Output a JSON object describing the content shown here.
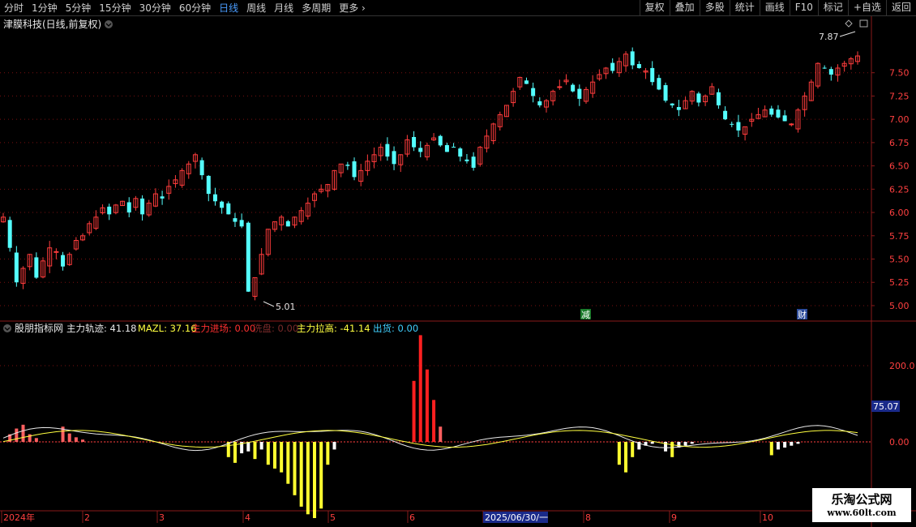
{
  "toolbar": {
    "timeframes": [
      {
        "label": "分时"
      },
      {
        "label": "1分钟"
      },
      {
        "label": "5分钟"
      },
      {
        "label": "15分钟"
      },
      {
        "label": "30分钟"
      },
      {
        "label": "60分钟"
      },
      {
        "label": "日线",
        "active": true
      },
      {
        "label": "周线"
      },
      {
        "label": "月线"
      },
      {
        "label": "多周期"
      },
      {
        "label": "更多"
      }
    ],
    "tools": [
      "复权",
      "叠加",
      "多股",
      "统计",
      "画线",
      "F10",
      "标记",
      "+自选",
      "返回"
    ]
  },
  "main_title": "津膜科技(日线,前复权)",
  "indicator_title": "股朋指标网",
  "indicator_values": [
    {
      "label": "主力轨迹: 41.18",
      "color": "#e8e8e8"
    },
    {
      "label": "MAZL: 37.16",
      "color": "#ffff40"
    },
    {
      "label": "主力进场: 0.00",
      "color": "#ff3030"
    },
    {
      "label": "洗盘: 0.00",
      "color": "#7a2a2a"
    },
    {
      "label": "主力拉高: -41.14",
      "color": "#ffff40"
    },
    {
      "label": "出货: 0.00",
      "color": "#40d0ff"
    }
  ],
  "price_axis": [
    "7.50",
    "7.25",
    "7.00",
    "6.75",
    "6.50",
    "6.25",
    "6.00",
    "5.75",
    "5.50",
    "5.25",
    "5.00"
  ],
  "indicator_axis": [
    "200.0",
    "0.00"
  ],
  "indicator_current": "75.07",
  "high_label": "7.87",
  "low_label": "5.01",
  "markers": [
    {
      "text": "减",
      "color": "#1a7a2a"
    },
    {
      "text": "财",
      "color": "#2a4a9a"
    }
  ],
  "date_axis": [
    "2024年",
    "2",
    "3",
    "4",
    "5",
    "6",
    "2025/06/30/一",
    "8",
    "9",
    "10"
  ],
  "watermark": {
    "line1": "乐淘公式网",
    "line2": "www.60lt.com"
  },
  "colors": {
    "up": "#ff3c3c",
    "down": "#54ffff",
    "grid": "#7a1010"
  },
  "chart_data": [
    {
      "type": "candlestick",
      "title": "津膜科技(日线,前复权)",
      "ylim": [
        4.93,
        7.95
      ],
      "yticks": [
        5.0,
        5.25,
        5.5,
        5.75,
        6.0,
        6.25,
        6.5,
        6.75,
        7.0,
        7.25,
        7.5
      ],
      "annotations": [
        {
          "text": "7.87",
          "type": "high"
        },
        {
          "text": "5.01",
          "type": "low"
        }
      ],
      "close_path": [
        5.95,
        5.62,
        5.25,
        5.4,
        5.55,
        5.3,
        5.48,
        5.62,
        5.58,
        5.42,
        5.55,
        5.7,
        5.75,
        5.88,
        5.95,
        6.05,
        5.98,
        6.08,
        6.12,
        6.0,
        6.15,
        5.98,
        6.1,
        6.2,
        6.15,
        6.28,
        6.35,
        6.45,
        6.52,
        6.62,
        6.4,
        6.2,
        6.12,
        6.05,
        5.98,
        5.9,
        5.85,
        5.15,
        5.3,
        5.55,
        5.82,
        5.9,
        5.95,
        5.85,
        5.95,
        6.02,
        6.1,
        6.2,
        6.25,
        6.3,
        6.45,
        6.52,
        6.5,
        6.38,
        6.45,
        6.55,
        6.62,
        6.7,
        6.6,
        6.52,
        6.62,
        6.78,
        6.7,
        6.65,
        6.72,
        6.8,
        6.72,
        6.65,
        6.7,
        6.6,
        6.55,
        6.48,
        6.7,
        6.82,
        6.95,
        7.05,
        7.15,
        7.3,
        7.45,
        7.38,
        7.25,
        7.15,
        7.2,
        7.3,
        7.35,
        7.42,
        7.3,
        7.22,
        7.32,
        7.4,
        7.48,
        7.55,
        7.52,
        7.62,
        7.7,
        7.58,
        7.55,
        7.52,
        7.4,
        7.32,
        7.2,
        7.15,
        7.1,
        7.2,
        7.3,
        7.18,
        7.25,
        7.35,
        7.15,
        7.0,
        6.95,
        6.88,
        6.92,
        7.0,
        7.05,
        7.1,
        7.05,
        7.02,
        6.98,
        6.95,
        7.1,
        7.25,
        7.4,
        7.6,
        7.55,
        7.48,
        7.55,
        7.6,
        7.65,
        7.68
      ]
    },
    {
      "type": "bar+line",
      "title": "股朋指标网",
      "ylim": [
        -420,
        380
      ],
      "yticks": [
        0,
        200
      ],
      "series": [
        {
          "name": "主力轨迹",
          "value": 41.18
        },
        {
          "name": "MAZL",
          "value": 37.16
        },
        {
          "name": "主力进场",
          "value": 0.0
        },
        {
          "name": "洗盘",
          "value": 0.0
        },
        {
          "name": "主力拉高",
          "value": -41.14
        },
        {
          "name": "出货",
          "value": 0.0
        }
      ]
    }
  ]
}
